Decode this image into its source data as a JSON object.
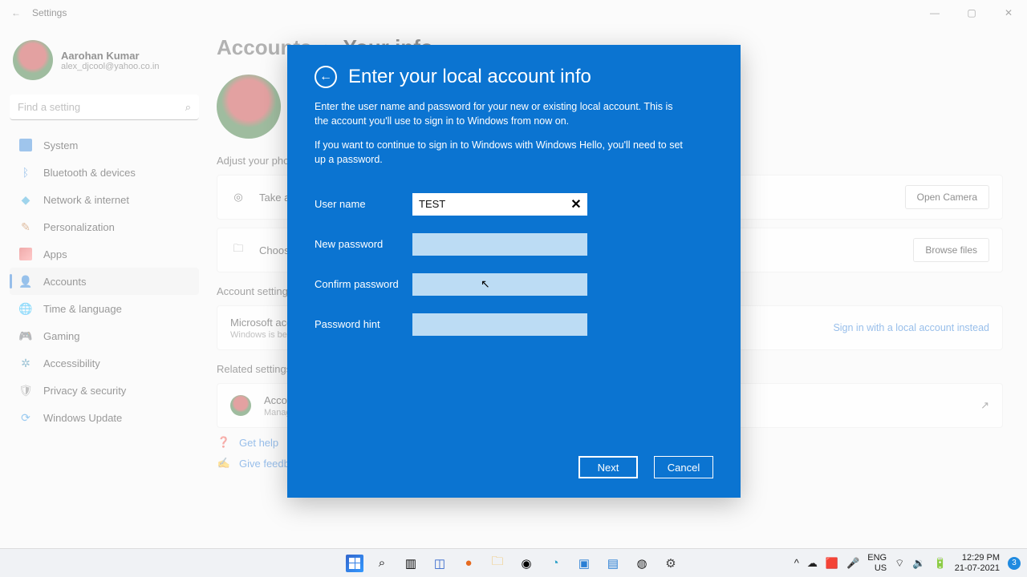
{
  "window": {
    "title": "Settings",
    "controls": {
      "min": "—",
      "max": "▢",
      "close": "✕"
    }
  },
  "profile": {
    "name": "Aarohan Kumar",
    "email": "alex_djcool@yahoo.co.in"
  },
  "search": {
    "placeholder": "Find a setting"
  },
  "sidebar": {
    "items": [
      {
        "label": "System"
      },
      {
        "label": "Bluetooth & devices"
      },
      {
        "label": "Network & internet"
      },
      {
        "label": "Personalization"
      },
      {
        "label": "Apps"
      },
      {
        "label": "Accounts"
      },
      {
        "label": "Time & language"
      },
      {
        "label": "Gaming"
      },
      {
        "label": "Accessibility"
      },
      {
        "label": "Privacy & security"
      },
      {
        "label": "Windows Update"
      }
    ]
  },
  "breadcrumb": {
    "parent": "Accounts",
    "sep": "›",
    "current": "Your info"
  },
  "sections": {
    "adjust_photo": "Adjust your photo",
    "account_settings": "Account settings",
    "related_settings": "Related settings"
  },
  "cards": {
    "take_photo": {
      "label": "Take a photo",
      "button": "Open Camera"
    },
    "choose_file": {
      "label": "Choose a file",
      "button": "Browse files"
    },
    "ms_account": {
      "title": "Microsoft account",
      "sub": "Windows is better when ...",
      "link": "Sign in with a local account instead"
    },
    "accounts": {
      "title": "Accounts",
      "sub": "Manage"
    }
  },
  "help": {
    "get_help": "Get help",
    "feedback": "Give feedback"
  },
  "modal": {
    "title": "Enter your local account info",
    "desc1": "Enter the user name and password for your new or existing local account. This is the account you'll use to sign in to Windows from now on.",
    "desc2": "If you want to continue to sign in to Windows with Windows Hello, you'll need to set up a password.",
    "labels": {
      "username": "User name",
      "new_pw": "New password",
      "confirm_pw": "Confirm password",
      "hint": "Password hint"
    },
    "values": {
      "username": "TEST"
    },
    "buttons": {
      "next": "Next",
      "cancel": "Cancel"
    }
  },
  "taskbar": {
    "lang1": "ENG",
    "lang2": "US",
    "time": "12:29 PM",
    "date": "21-07-2021",
    "badge": "3"
  }
}
